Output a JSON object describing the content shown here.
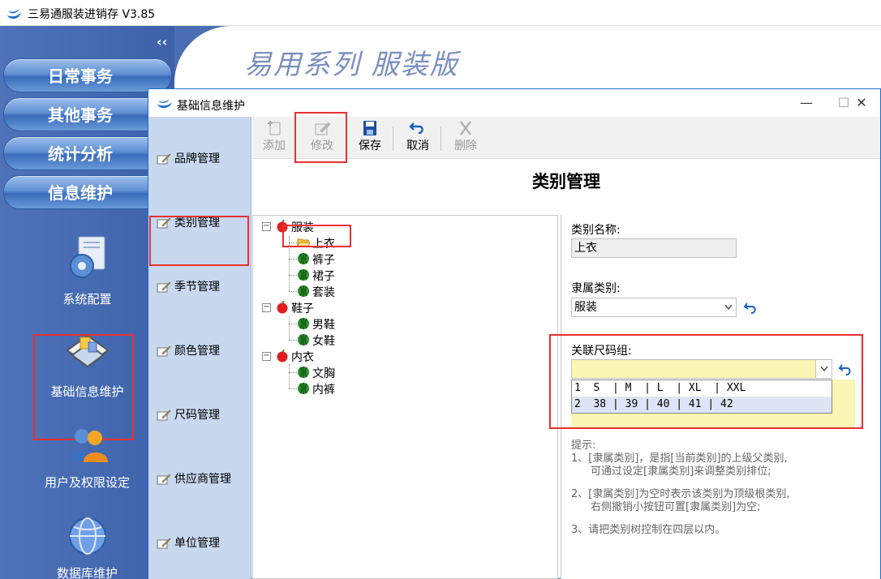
{
  "app": {
    "title": "三易通服装进销存 V3.85",
    "brand": "易用系列 服装版",
    "collapse_glyph": "‹‹"
  },
  "nav": {
    "buttons": [
      "日常事务",
      "其他事务",
      "统计分析",
      "信息维护"
    ]
  },
  "tools": {
    "system_config": "系统配置",
    "basic_info": "基础信息维护",
    "user_rights": "用户及权限设定",
    "db_maintenance": "数据库维护"
  },
  "dialog": {
    "title": "基础信息维护",
    "controls": {
      "minimize": "—",
      "maximize": "☐",
      "close": "✕"
    }
  },
  "mgmt": {
    "items": [
      "品牌管理",
      "类别管理",
      "季节管理",
      "颜色管理",
      "尺码管理",
      "供应商管理",
      "单位管理"
    ]
  },
  "toolbar": {
    "add": "添加",
    "edit": "修改",
    "save": "保存",
    "cancel": "取消",
    "delete": "删除"
  },
  "page_title": "类别管理",
  "tree": {
    "nodes": [
      {
        "label": "服装",
        "level": 0
      },
      {
        "label": "上衣",
        "level": 1
      },
      {
        "label": "裤子",
        "level": 1
      },
      {
        "label": "裙子",
        "level": 1
      },
      {
        "label": "套装",
        "level": 1
      },
      {
        "label": "鞋子",
        "level": 0
      },
      {
        "label": "男鞋",
        "level": 1
      },
      {
        "label": "女鞋",
        "level": 1
      },
      {
        "label": "内衣",
        "level": 0
      },
      {
        "label": "文胸",
        "level": 1
      },
      {
        "label": "内裤",
        "level": 1
      }
    ]
  },
  "form": {
    "category_name_label": "类别名称:",
    "category_name_value": "上衣",
    "parent_label": "隶属类别:",
    "parent_value": "服装",
    "size_group_label": "关联尺码组:",
    "size_group_value": "",
    "size_options": [
      "1  S  | M  | L  | XL  | XXL",
      "2  38 | 39 | 40 | 41 | 42"
    ],
    "tips": {
      "heading": "提示:",
      "line1a": "1、[隶属类别]，是指[当前类别]的上级父类别,",
      "line1b": "可通过设定[隶属类别]来调整类别排位;",
      "line2a": "2、[隶属类别]为空时表示该类别为顶级根类别,",
      "line2b": "右侧撤销小按钮可置[隶属类别]为空;",
      "line3": "3、请把类别树控制在四层以内。"
    }
  },
  "colors": {
    "nav_blue": "#4469b1",
    "dialog_side": "#c7d8ef",
    "highlight_red": "#e83030",
    "field_yellow": "#fbf6b5"
  }
}
